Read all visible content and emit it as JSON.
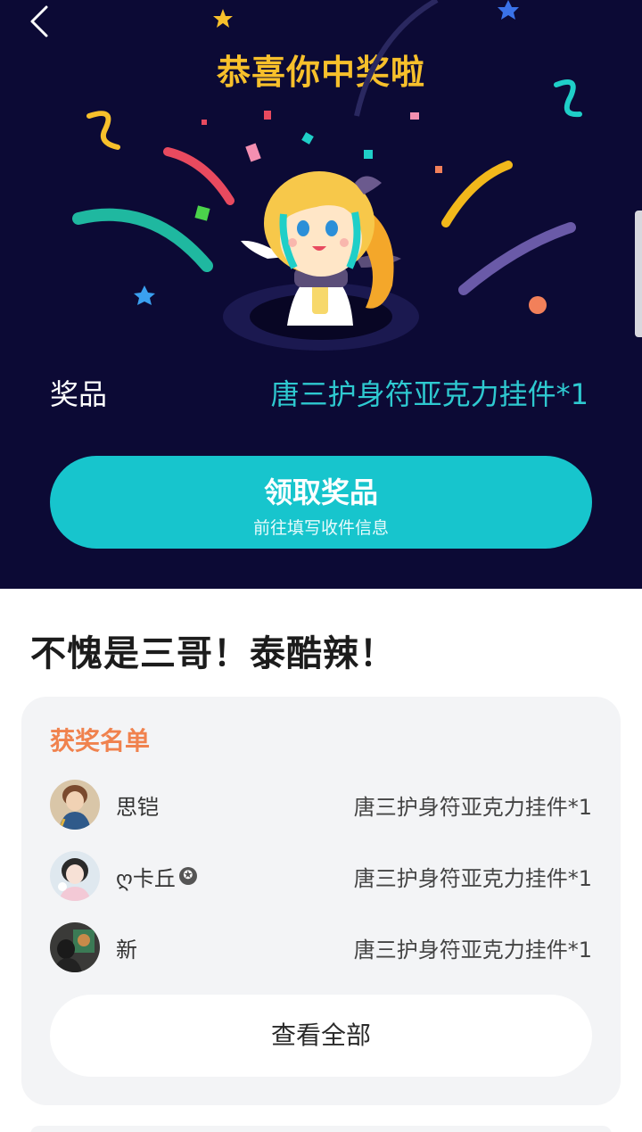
{
  "header": {
    "title": "恭喜你中奖啦"
  },
  "prize": {
    "label": "奖品",
    "value": "唐三护身符亚克力挂件*1"
  },
  "claim_button": {
    "label": "领取奖品",
    "sublabel": "前往填写收件信息"
  },
  "headline": "不愧是三哥！泰酷辣！",
  "winners": {
    "title": "获奖名单",
    "items": [
      {
        "name": "思铠",
        "prize": "唐三护身符亚克力挂件*1"
      },
      {
        "name": "ღ卡丘",
        "prize": "唐三护身符亚克力挂件*1"
      },
      {
        "name": "新",
        "prize": "唐三护身符亚克力挂件*1"
      }
    ],
    "view_all_label": "查看全部"
  },
  "colors": {
    "hero_background": "#0c0a35",
    "title_gold": "#f7c02b",
    "prize_teal": "#2ec9d0",
    "button_teal": "#17c5cd",
    "winners_orange": "#f0824e"
  },
  "icons": [
    "back-arrow-icon",
    "verified-badge-icon"
  ]
}
